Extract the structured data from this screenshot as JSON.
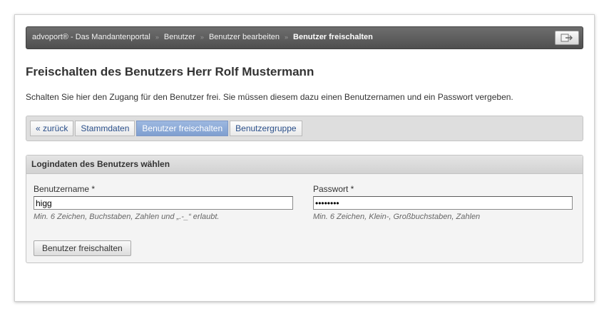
{
  "breadcrumb": {
    "items": [
      "advoport® - Das Mandantenportal",
      "Benutzer",
      "Benutzer bearbeiten"
    ],
    "current": "Benutzer freischalten",
    "separator": "»"
  },
  "logout_icon": "logout-icon",
  "page": {
    "title": "Freischalten des Benutzers Herr Rolf Mustermann",
    "intro": "Schalten Sie hier den Zugang für den Benutzer frei. Sie müssen diesem dazu einen Benutzernamen und ein Passwort vergeben."
  },
  "tabs": [
    {
      "label": "« zurück",
      "active": false
    },
    {
      "label": "Stammdaten",
      "active": false
    },
    {
      "label": "Benutzer freischalten",
      "active": true
    },
    {
      "label": "Benutzergruppe",
      "active": false
    }
  ],
  "panel": {
    "title": "Logindaten des Benutzers wählen",
    "username": {
      "label": "Benutzername *",
      "value": "higg",
      "hint": "Min. 6 Zeichen, Buchstaben, Zahlen und „.-_“ erlaubt."
    },
    "password": {
      "label": "Passwort *",
      "value": "••••••••",
      "hint": "Min. 6 Zeichen, Klein-, Großbuchstaben, Zahlen"
    },
    "submit_label": "Benutzer freischalten"
  },
  "colors": {
    "crumbbar": "#5a5a5a",
    "active_tab": "#87a5d4",
    "link": "#2a4f8a"
  }
}
